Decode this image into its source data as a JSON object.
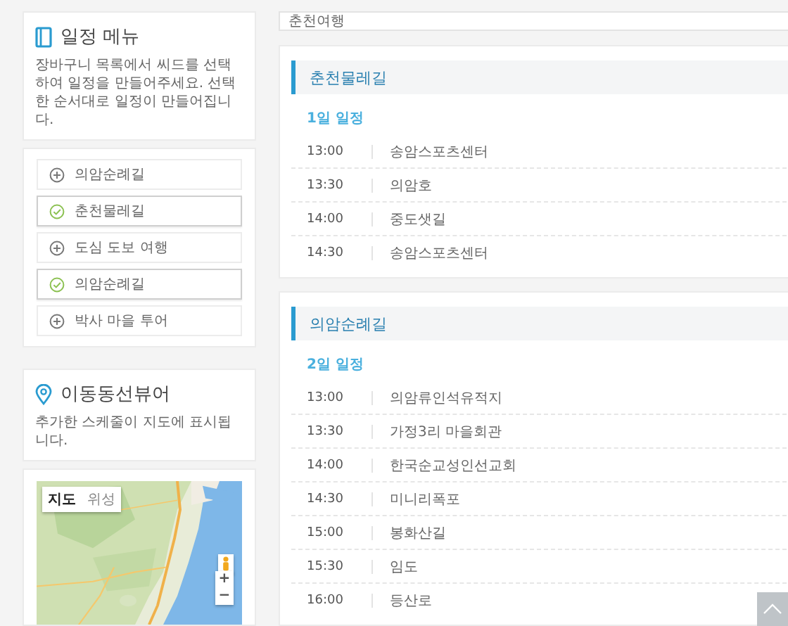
{
  "menu": {
    "title": "일정 메뉴",
    "description": "장바구니 목록에서 씨드를 선택하여 일정을 만들어주세요. 선택한 순서대로 일정이 만들어집니다."
  },
  "courses": [
    {
      "label": "의암순례길",
      "selected": false
    },
    {
      "label": "춘천물레길",
      "selected": true
    },
    {
      "label": "도심 도보 여행",
      "selected": false
    },
    {
      "label": "의암순례길",
      "selected": true
    },
    {
      "label": "박사 마을 투어",
      "selected": false
    }
  ],
  "route_viewer": {
    "title": "이동동선뷰어",
    "description": "추가한 스케줄이 지도에 표시됩니다.",
    "map": {
      "kind": "picture",
      "tabs": [
        {
          "label": "지도",
          "selected": true
        },
        {
          "label": "위성",
          "selected": false
        }
      ],
      "zoom_in": "+",
      "zoom_out": "−"
    }
  },
  "search": {
    "value": "춘천여행"
  },
  "itinerary": [
    {
      "title": "춘천물레길",
      "day": "1일 일정",
      "stops": [
        {
          "time": "13:00",
          "place": "송암스포츠센터"
        },
        {
          "time": "13:30",
          "place": "의암호"
        },
        {
          "time": "14:00",
          "place": "중도샛길"
        },
        {
          "time": "14:30",
          "place": "송암스포츠센터"
        }
      ]
    },
    {
      "title": "의암순례길",
      "day": "2일 일정",
      "stops": [
        {
          "time": "13:00",
          "place": "의암류인석유적지"
        },
        {
          "time": "13:30",
          "place": "가정3리 마을회관"
        },
        {
          "time": "14:00",
          "place": "한국순교성인선교회"
        },
        {
          "time": "14:30",
          "place": "미니리폭포"
        },
        {
          "time": "15:00",
          "place": "봉화산길"
        },
        {
          "time": "15:30",
          "place": "임도"
        },
        {
          "time": "16:00",
          "place": "등산로"
        }
      ]
    }
  ]
}
